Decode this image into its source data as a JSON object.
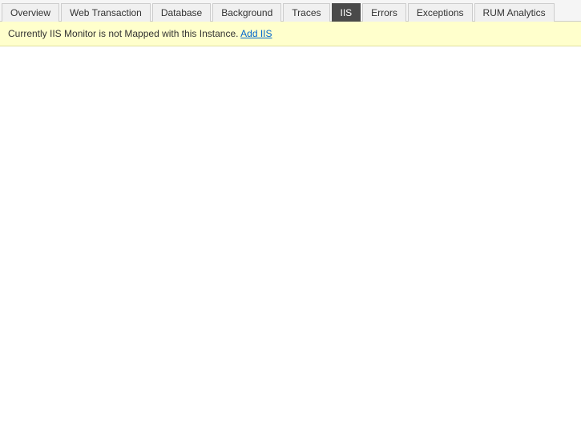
{
  "tabs": [
    {
      "id": "overview",
      "label": "Overview",
      "active": false
    },
    {
      "id": "web-transaction",
      "label": "Web Transaction",
      "active": false
    },
    {
      "id": "database",
      "label": "Database",
      "active": false
    },
    {
      "id": "background",
      "label": "Background",
      "active": false
    },
    {
      "id": "traces",
      "label": "Traces",
      "active": false
    },
    {
      "id": "iis",
      "label": "IIS",
      "active": true
    },
    {
      "id": "errors",
      "label": "Errors",
      "active": false
    },
    {
      "id": "exceptions",
      "label": "Exceptions",
      "active": false
    },
    {
      "id": "rum-analytics",
      "label": "RUM Analytics",
      "active": false
    }
  ],
  "notification": {
    "message": "Currently IIS Monitor is not Mapped with this Instance.",
    "link_text": "Add IIS"
  }
}
